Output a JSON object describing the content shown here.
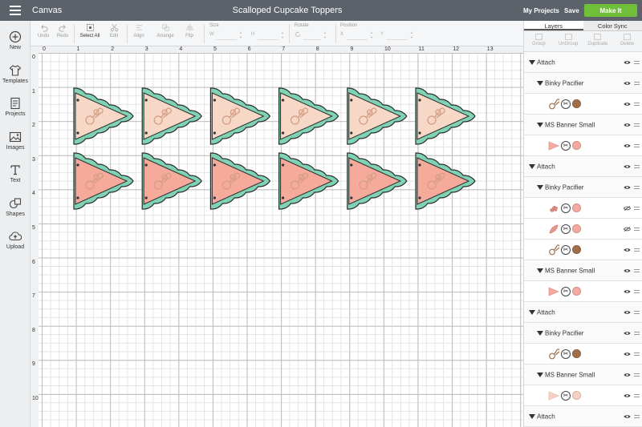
{
  "header": {
    "app_title": "Canvas",
    "doc_title": "Scalloped Cupcake Toppers",
    "my_projects": "My Projects",
    "save": "Save",
    "make_it": "Make It"
  },
  "sidebar": {
    "items": [
      {
        "label": "New",
        "icon": "plus-circle-icon"
      },
      {
        "label": "Templates",
        "icon": "shirt-icon"
      },
      {
        "label": "Projects",
        "icon": "projects-icon"
      },
      {
        "label": "Images",
        "icon": "image-icon"
      },
      {
        "label": "Text",
        "icon": "text-icon"
      },
      {
        "label": "Shapes",
        "icon": "shapes-icon"
      },
      {
        "label": "Upload",
        "icon": "upload-cloud-icon"
      }
    ]
  },
  "toolbar": {
    "undo": "Undo",
    "redo": "Redo",
    "select_all": "Select All",
    "edit": "Edit",
    "align": "Align",
    "arrange": "Arrange",
    "flip": "Flip",
    "size_label": "Size",
    "w_label": "W",
    "h_label": "H",
    "rotate_label": "Rotate",
    "position_label": "Position",
    "x_label": "X",
    "y_label": "Y"
  },
  "rulers": {
    "top": [
      "0",
      "1",
      "2",
      "3",
      "4",
      "5",
      "6",
      "7",
      "8",
      "9",
      "10",
      "11",
      "12",
      "13"
    ],
    "left": [
      "0",
      "1",
      "2",
      "3",
      "4",
      "5",
      "6",
      "7",
      "8",
      "9",
      "10"
    ]
  },
  "canvas": {
    "banners": {
      "columns": 6,
      "rows": [
        {
          "fill": "#f7d7c5",
          "scallop": "#7fd3b4"
        },
        {
          "fill": "#f5aa9c",
          "scallop": "#7fd3b4"
        }
      ]
    }
  },
  "layers_panel": {
    "tabs": [
      "Layers",
      "Color Sync"
    ],
    "actions": [
      "Group",
      "UnGroup",
      "Duplicate",
      "Delete"
    ],
    "rows": [
      {
        "kind": "attach",
        "label": "Attach"
      },
      {
        "kind": "group",
        "label": "Binky Pacifier"
      },
      {
        "kind": "item",
        "shape": "pacifier",
        "dot": "#a06f4a"
      },
      {
        "kind": "group",
        "label": "MS Banner Small"
      },
      {
        "kind": "item",
        "shape": "flag",
        "dot": "#f5aaa0"
      },
      {
        "kind": "attach",
        "label": "Attach"
      },
      {
        "kind": "group",
        "label": "Binky Pacifier"
      },
      {
        "kind": "item",
        "shape": "blob",
        "dot": "#f5aaa0",
        "hidden": true
      },
      {
        "kind": "item",
        "shape": "leaf",
        "dot": "#f5aaa0",
        "hidden": true
      },
      {
        "kind": "item",
        "shape": "pacifier",
        "dot": "#a06f4a"
      },
      {
        "kind": "group",
        "label": "MS Banner Small"
      },
      {
        "kind": "item",
        "shape": "flag",
        "dot": "#f5aaa0"
      },
      {
        "kind": "attach",
        "label": "Attach"
      },
      {
        "kind": "group",
        "label": "Binky Pacifier"
      },
      {
        "kind": "item",
        "shape": "pacifier",
        "dot": "#a06f4a"
      },
      {
        "kind": "group",
        "label": "MS Banner Small"
      },
      {
        "kind": "item",
        "shape": "flag-light",
        "dot": "#f7d2c3"
      },
      {
        "kind": "attach",
        "label": "Attach"
      }
    ]
  }
}
